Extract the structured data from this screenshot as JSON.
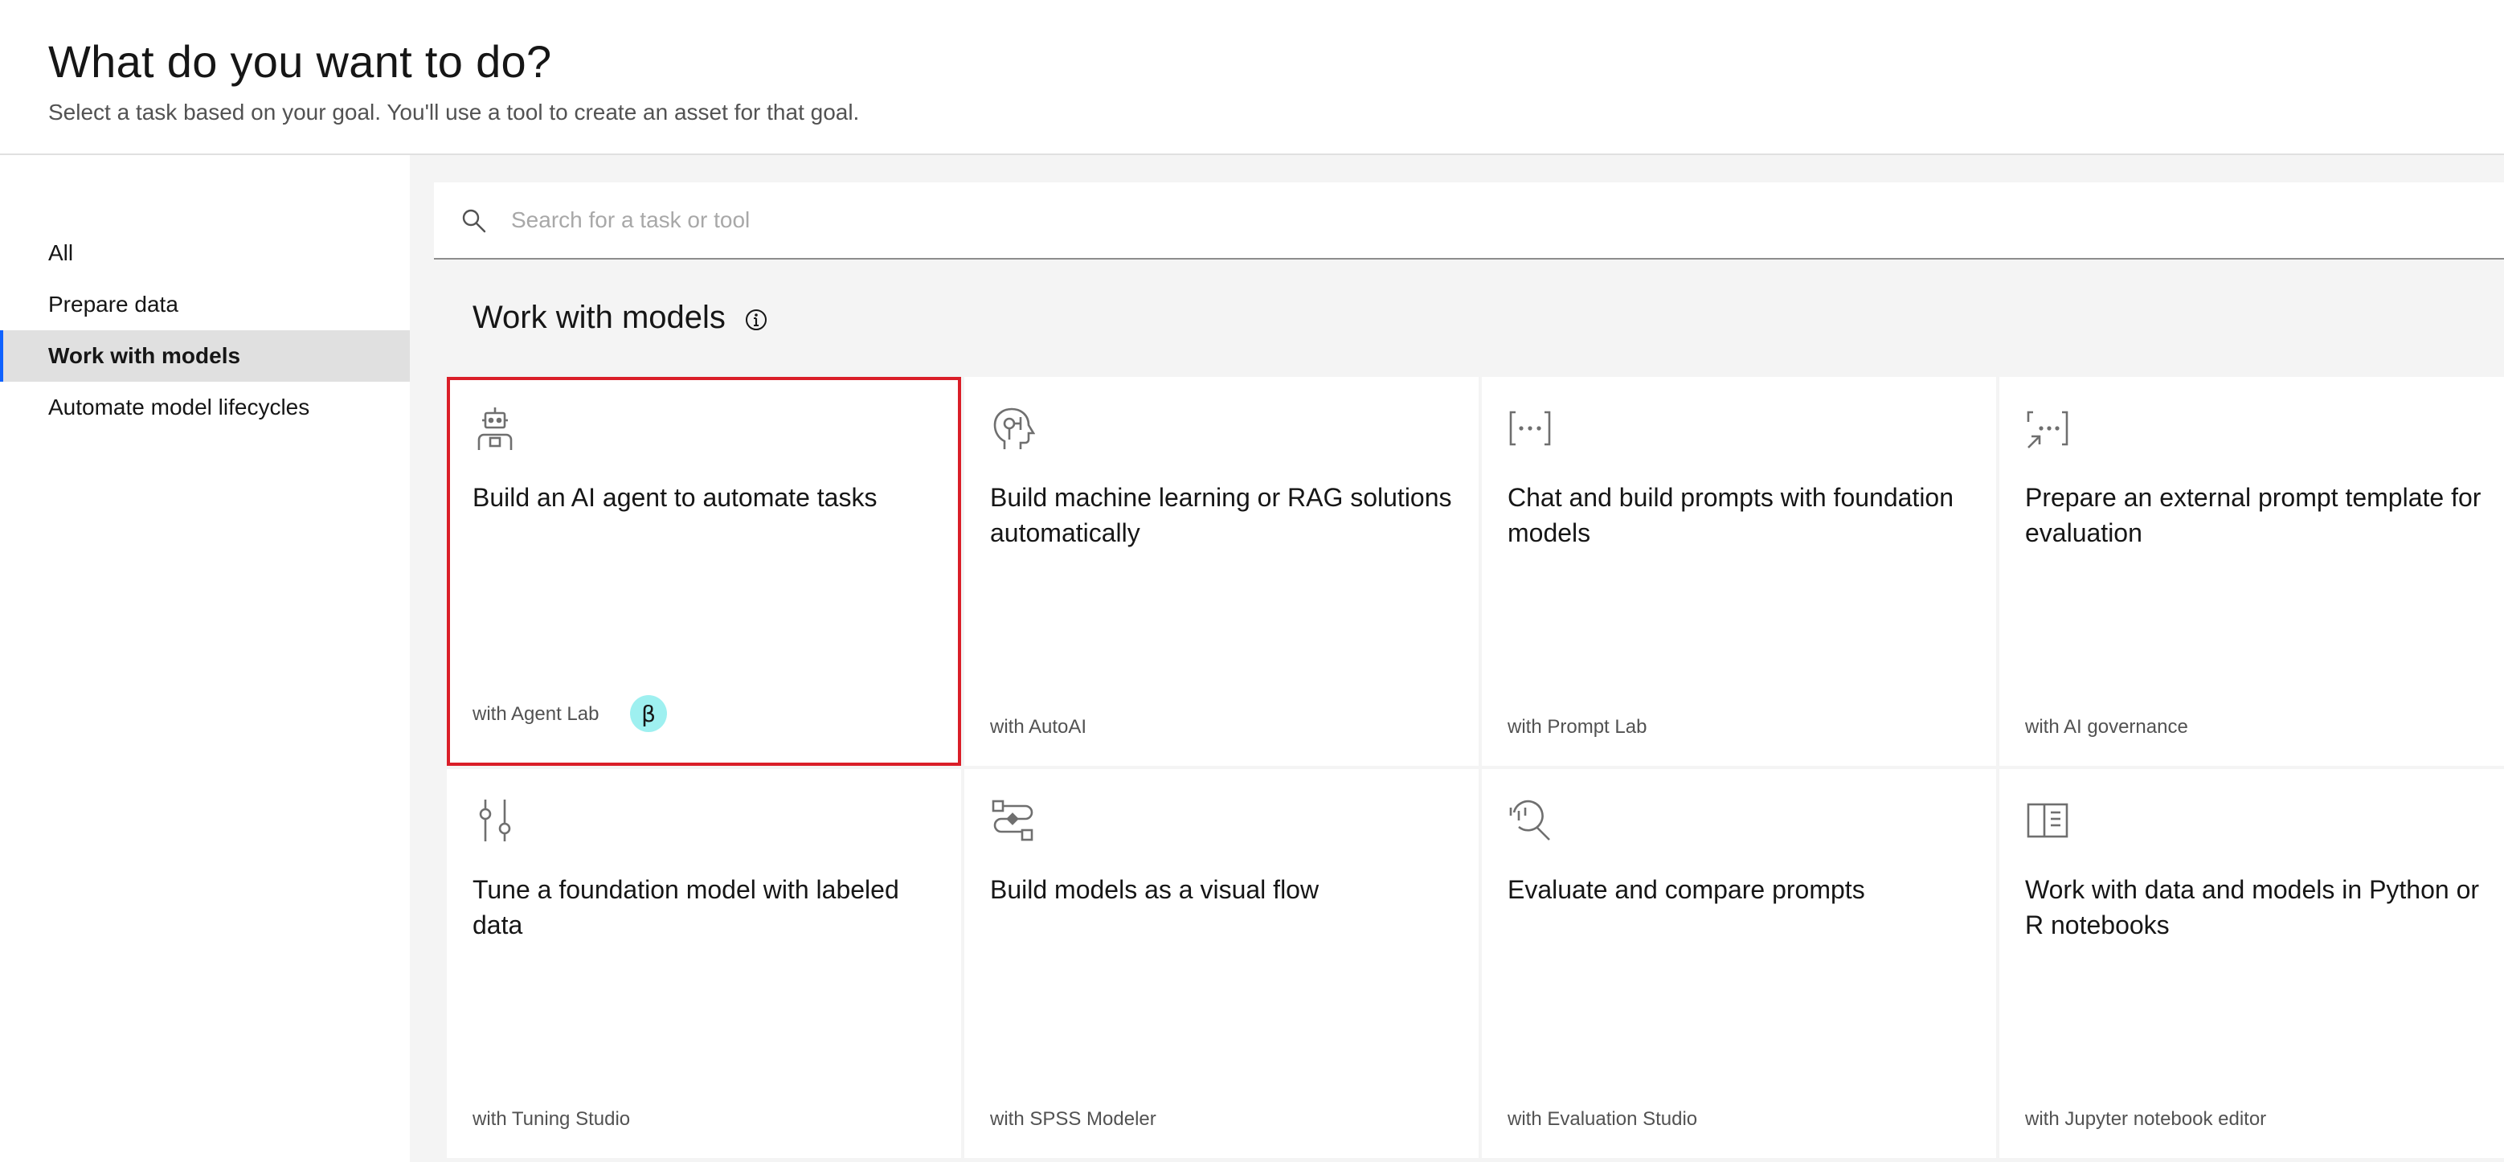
{
  "header": {
    "title": "What do you want to do?",
    "subtitle": "Select a task based on your goal. You'll use a tool to create an asset for that goal."
  },
  "sidebar": {
    "items": [
      {
        "label": "All",
        "active": false
      },
      {
        "label": "Prepare data",
        "active": false
      },
      {
        "label": "Work with models",
        "active": true
      },
      {
        "label": "Automate model lifecycles",
        "active": false
      }
    ]
  },
  "search": {
    "placeholder": "Search for a task or tool",
    "value": "",
    "icon": "search-icon"
  },
  "section": {
    "title": "Work with models",
    "info_icon": "info-icon"
  },
  "cards": [
    {
      "title": "Build an AI agent to automate tasks",
      "tool": "with Agent Lab",
      "icon": "robot-icon",
      "badge": "β",
      "selected": true
    },
    {
      "title": "Build machine learning or RAG solutions automatically",
      "tool": "with AutoAI",
      "icon": "ai-head-icon",
      "selected": false
    },
    {
      "title": "Chat and build prompts with foundation models",
      "tool": "with Prompt Lab",
      "icon": "prompt-brackets-icon",
      "selected": false
    },
    {
      "title": "Prepare an external prompt template for evaluation",
      "tool": "with AI governance",
      "icon": "external-prompt-icon",
      "selected": false
    },
    {
      "title": "Tune a foundation model with labeled data",
      "tool": "with Tuning Studio",
      "icon": "tuning-sliders-icon",
      "selected": false
    },
    {
      "title": "Build models as a visual flow",
      "tool": "with SPSS Modeler",
      "icon": "flow-icon",
      "selected": false
    },
    {
      "title": "Evaluate and compare prompts",
      "tool": "with Evaluation Studio",
      "icon": "evaluate-magnifier-icon",
      "selected": false
    },
    {
      "title": "Work with data and models in Python or R notebooks",
      "tool": "with Jupyter notebook editor",
      "icon": "notebook-icon",
      "selected": false
    }
  ],
  "colors": {
    "selection_border": "#da1e28",
    "active_nav_indicator": "#0f62fe",
    "beta_badge": "#9ef0f0"
  }
}
